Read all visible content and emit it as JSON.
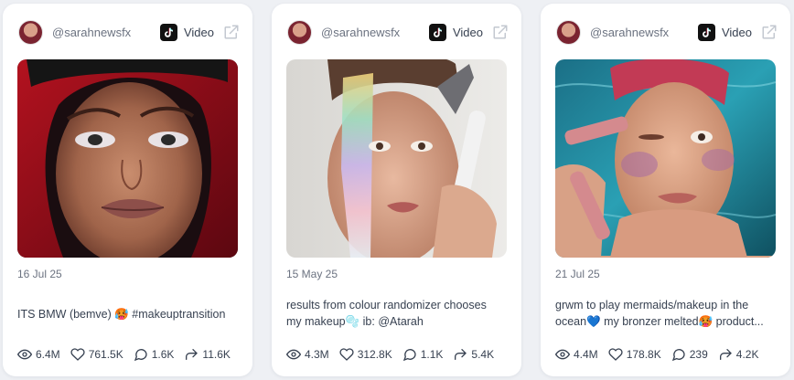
{
  "cards": [
    {
      "handle": "@sarahnewsfx",
      "type_label": "Video",
      "date": "16 Jul 25",
      "caption_lines": [
        "ITS BMW (bemve) 🥵 #makeuptransition"
      ],
      "stats": {
        "views": "6.4M",
        "likes": "761.5K",
        "comments": "1.6K",
        "shares": "11.6K"
      }
    },
    {
      "handle": "@sarahnewsfx",
      "type_label": "Video",
      "date": "15 May 25",
      "caption_lines": [
        "results from colour randomizer chooses",
        "my makeup🫧 ib: @Atarah"
      ],
      "stats": {
        "views": "4.3M",
        "likes": "312.8K",
        "comments": "1.1K",
        "shares": "5.4K"
      }
    },
    {
      "handle": "@sarahnewsfx",
      "type_label": "Video",
      "date": "21 Jul 25",
      "caption_lines": [
        "grwm to play mermaids/makeup in the",
        "ocean💙 my bronzer melted🥵 product..."
      ],
      "stats": {
        "views": "4.4M",
        "likes": "178.8K",
        "comments": "239",
        "shares": "4.2K"
      }
    }
  ],
  "icons": {
    "platform": "tiktok-icon",
    "external": "external-link-icon",
    "views": "eye-icon",
    "likes": "heart-icon",
    "comments": "comment-icon",
    "shares": "share-icon"
  },
  "colors": {
    "page_bg": "#eef0f4",
    "card_bg": "#ffffff",
    "text": "#374151",
    "muted": "#6b7280"
  }
}
